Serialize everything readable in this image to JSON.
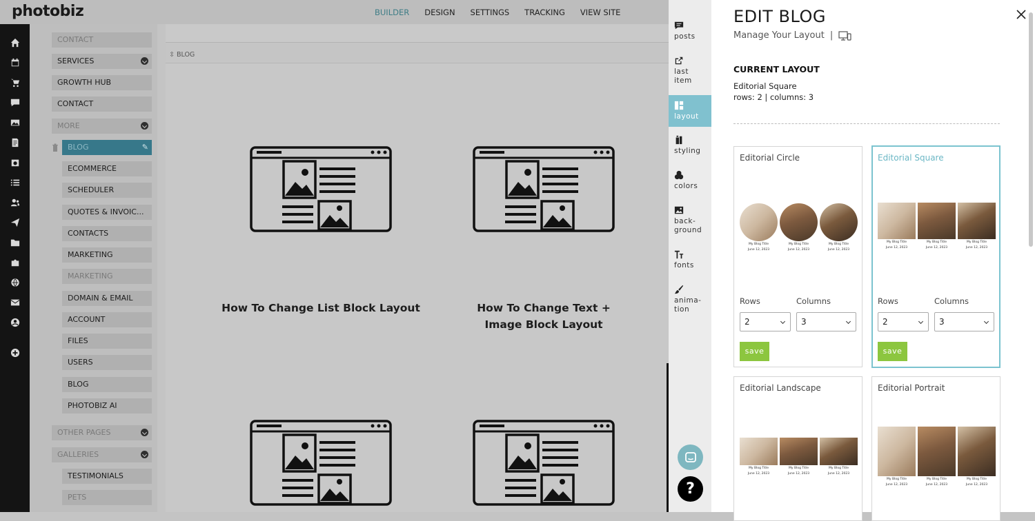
{
  "app": {
    "logo": "photobiz"
  },
  "topnav": [
    {
      "label": "BUILDER",
      "active": true
    },
    {
      "label": "DESIGN",
      "active": false
    },
    {
      "label": "SETTINGS",
      "active": false
    },
    {
      "label": "TRACKING",
      "active": false
    },
    {
      "label": "VIEW SITE",
      "active": false
    }
  ],
  "rail_icons": [
    "home-icon",
    "calendar-icon",
    "cart-icon",
    "chat-icon",
    "photo-icon",
    "document-icon",
    "schedule-icon",
    "list-icon",
    "people-icon",
    "send-icon",
    "folder-icon",
    "puzzle-icon",
    "globe-icon",
    "mail-icon",
    "account-icon",
    "add-icon"
  ],
  "pages": [
    {
      "label": "CONTACT",
      "state": "faded"
    },
    {
      "label": "SERVICES",
      "state": "normal",
      "chevron": true
    },
    {
      "label": "GROWTH HUB",
      "state": "normal"
    },
    {
      "label": "CONTACT",
      "state": "normal"
    },
    {
      "label": "MORE",
      "state": "faded",
      "chevron": true
    },
    {
      "label": "BLOG",
      "state": "selected"
    },
    {
      "label": "ECOMMERCE",
      "state": "normal"
    },
    {
      "label": "SCHEDULER",
      "state": "normal"
    },
    {
      "label": "QUOTES & INVOIC...",
      "state": "normal"
    },
    {
      "label": "CONTACTS",
      "state": "normal"
    },
    {
      "label": "MARKETING",
      "state": "normal"
    },
    {
      "label": "MARKETING",
      "state": "faded"
    },
    {
      "label": "DOMAIN & EMAIL",
      "state": "normal"
    },
    {
      "label": "ACCOUNT",
      "state": "normal"
    },
    {
      "label": "FILES",
      "state": "normal"
    },
    {
      "label": "USERS",
      "state": "normal"
    },
    {
      "label": "BLOG",
      "state": "normal"
    },
    {
      "label": "PHOTOBIZ AI",
      "state": "normal"
    },
    {
      "label": "OTHER PAGES",
      "state": "faded",
      "chevron": true
    },
    {
      "label": "GALLERIES",
      "state": "faded",
      "chevron": true
    },
    {
      "label": "TESTIMONIALS",
      "state": "normal"
    },
    {
      "label": "PETS",
      "state": "faded"
    }
  ],
  "canvas": {
    "section_label": "BLOG",
    "posts": [
      {
        "title": "How To Change List Block Layout"
      },
      {
        "title": "How To Change Text + Image Block Layout"
      }
    ]
  },
  "tabs": [
    {
      "label": "posts",
      "icon": "comment-icon",
      "active": false
    },
    {
      "label": "last item",
      "icon": "share-icon",
      "active": false
    },
    {
      "label": "layout",
      "icon": "layout-icon",
      "active": true
    },
    {
      "label": "styling",
      "icon": "paint-bucket-icon",
      "active": false
    },
    {
      "label": "colors",
      "icon": "palette-icon",
      "active": false
    },
    {
      "label": "back-ground",
      "icon": "image-icon",
      "active": false
    },
    {
      "label": "fonts",
      "icon": "font-icon",
      "active": false
    },
    {
      "label": "anima-tion",
      "icon": "brush-icon",
      "active": false
    }
  ],
  "panel": {
    "title": "EDIT BLOG",
    "subtitle": "Manage Your Layout",
    "separator": "|",
    "current_heading": "CURRENT LAYOUT",
    "current_name": "Editorial Square",
    "current_info": "rows: 2 | columns: 3",
    "rows_label": "Rows",
    "columns_label": "Columns",
    "save_label": "save",
    "thumb_caption_title": "My Blog Title",
    "thumb_caption_date": "June 12, 2023",
    "layouts": [
      {
        "name": "Editorial Circle",
        "rows": "2",
        "columns": "3",
        "selected": false
      },
      {
        "name": "Editorial Square",
        "rows": "2",
        "columns": "3",
        "selected": true
      },
      {
        "name": "Editorial Landscape",
        "selected": false
      },
      {
        "name": "Editorial Portrait",
        "selected": false
      }
    ]
  },
  "colors": {
    "accent": "#7bc3cf",
    "save": "#8cc63f",
    "selected_page": "#37788a"
  }
}
